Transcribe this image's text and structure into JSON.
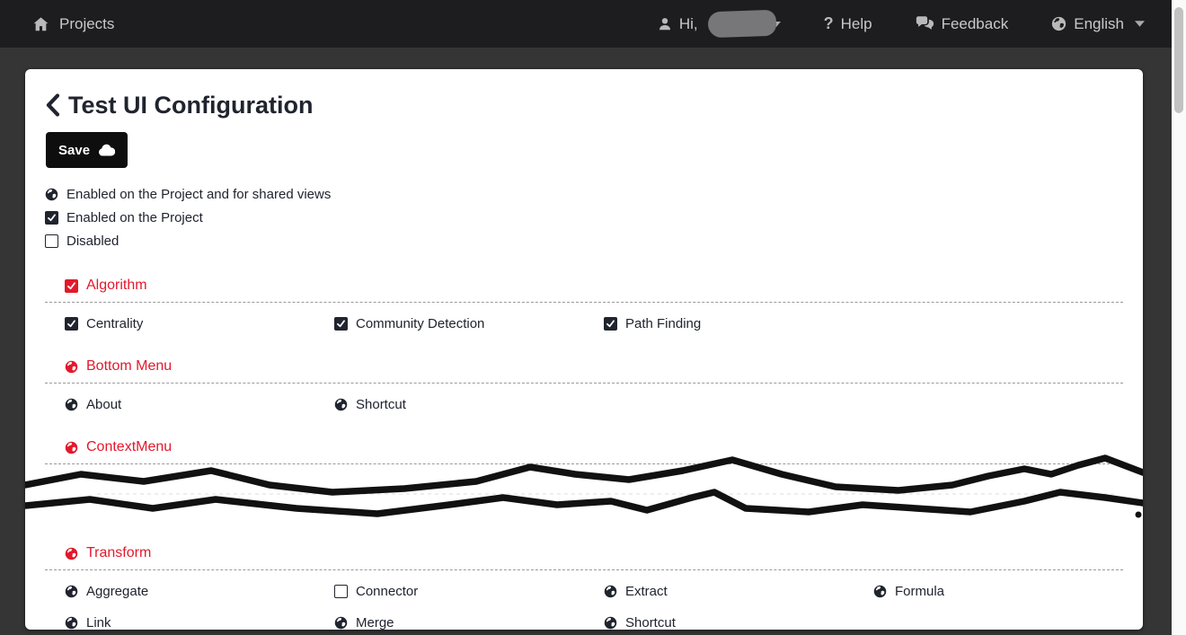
{
  "colors": {
    "accent_red": "#e2192c",
    "topbar_bg": "#1d1d1f",
    "page_bg": "#353535"
  },
  "topbar": {
    "projects_label": "Projects",
    "greeting_prefix": "Hi,",
    "help_label": "Help",
    "help_glyph": "?",
    "feedback_label": "Feedback",
    "language_label": "English"
  },
  "page": {
    "title": "Test UI Configuration",
    "save_label": "Save"
  },
  "legend": [
    {
      "icon": "globe",
      "label": "Enabled on the Project and for shared views"
    },
    {
      "icon": "checkbox-checked",
      "label": "Enabled on the Project"
    },
    {
      "icon": "checkbox-unchecked",
      "label": "Disabled"
    }
  ],
  "sections": [
    {
      "title": "Algorithm",
      "marker": "checkbox-checked-red",
      "torn": false,
      "items": [
        {
          "label": "Centrality",
          "marker": "checkbox-checked"
        },
        {
          "label": "Community Detection",
          "marker": "checkbox-checked"
        },
        {
          "label": "Path Finding",
          "marker": "checkbox-checked"
        }
      ]
    },
    {
      "title": "Bottom Menu",
      "marker": "globe-red",
      "torn": false,
      "items": [
        {
          "label": "About",
          "marker": "globe"
        },
        {
          "label": "Shortcut",
          "marker": "globe"
        }
      ]
    },
    {
      "title": "ContextMenu",
      "marker": "globe-red",
      "torn": true,
      "items": []
    },
    {
      "title": "Transform",
      "marker": "globe-red",
      "torn": false,
      "items": [
        {
          "label": "Aggregate",
          "marker": "globe"
        },
        {
          "label": "Connector",
          "marker": "checkbox-unchecked"
        },
        {
          "label": "Extract",
          "marker": "globe"
        },
        {
          "label": "Formula",
          "marker": "globe"
        },
        {
          "label": "Link",
          "marker": "globe"
        },
        {
          "label": "Merge",
          "marker": "globe"
        },
        {
          "label": "Shortcut",
          "marker": "globe"
        }
      ]
    }
  ]
}
